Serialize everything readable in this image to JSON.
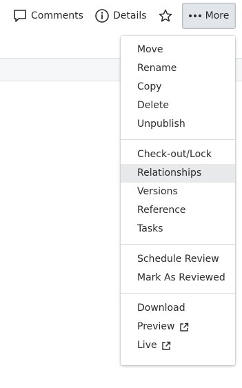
{
  "toolbar": {
    "comments_label": "Comments",
    "details_label": "Details",
    "more_label": "More"
  },
  "menu": {
    "group1": [
      "Move",
      "Rename",
      "Copy",
      "Delete",
      "Unpublish"
    ],
    "group2": [
      "Check-out/Lock",
      "Relationships",
      "Versions",
      "Reference",
      "Tasks"
    ],
    "group3": [
      "Schedule Review",
      "Mark As Reviewed"
    ],
    "group4": [
      "Download",
      "Preview",
      "Live"
    ],
    "highlighted_item": "Relationships"
  },
  "icons": {
    "comments": "speech-bubble-icon",
    "details": "info-circle-icon",
    "favorite": "star-icon",
    "more": "ellipsis-icon",
    "external": "external-link-icon"
  },
  "colors": {
    "text": "#2b2b2b",
    "more_button_bg": "#e2e6ea",
    "highlight_bg": "#e8e9ea",
    "divider": "#d9dcdf"
  }
}
